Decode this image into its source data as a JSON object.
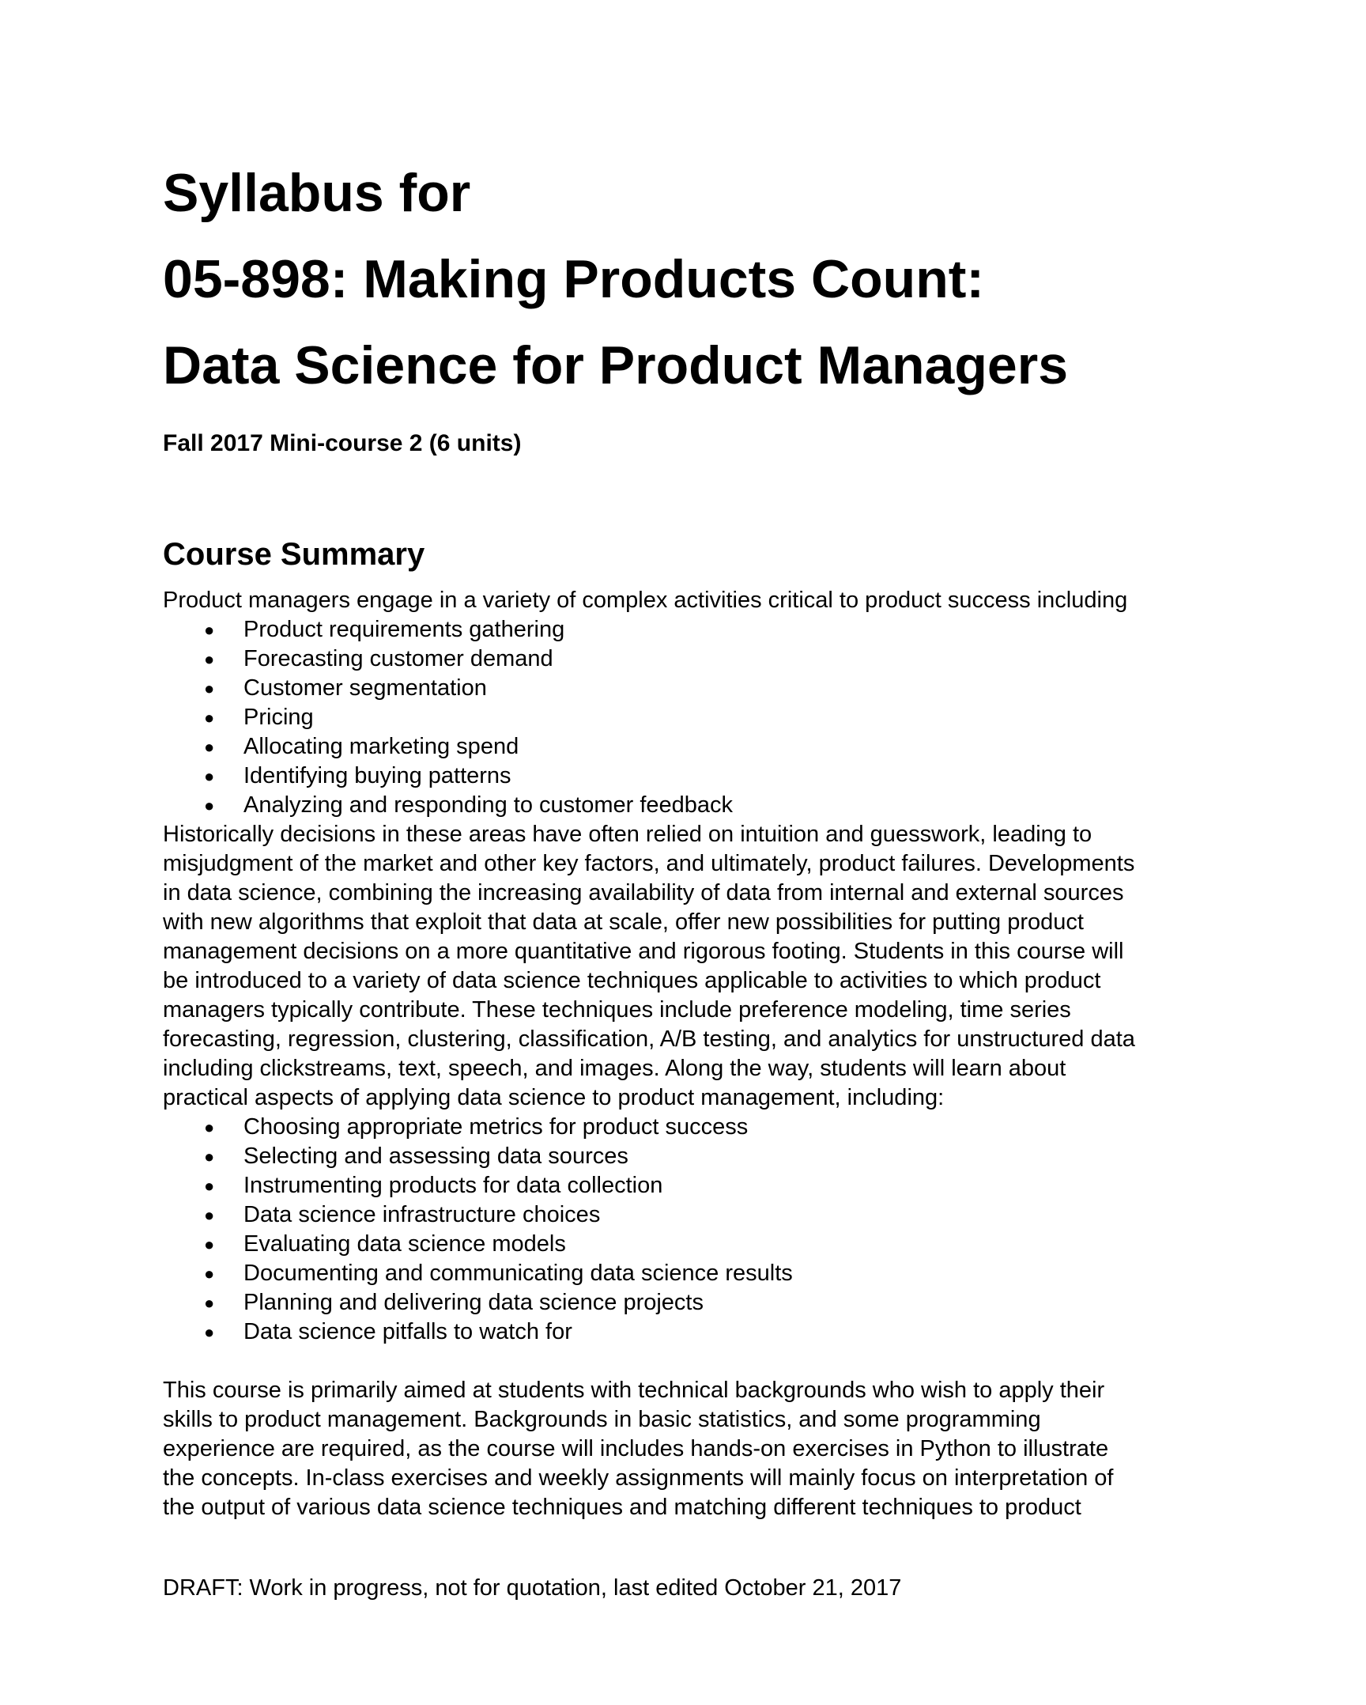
{
  "document": {
    "title_lines": [
      "Syllabus for",
      "05-898: Making Products Count:",
      "Data Science for Product Managers"
    ],
    "subtitle": "Fall 2017 Mini-course 2 (6 units)",
    "section_heading": "Course Summary",
    "intro": "Product managers engage in a variety of complex activities critical to product success including",
    "activities": [
      "Product requirements gathering",
      "Forecasting customer demand",
      "Customer segmentation",
      "Pricing",
      "Allocating marketing spend",
      "Identifying buying patterns",
      "Analyzing and responding to customer feedback"
    ],
    "body_lines": [
      "Historically decisions in these areas have often relied on intuition and guesswork, leading to",
      "misjudgment of the market and other key factors, and ultimately, product failures. Developments",
      "in data science, combining the increasing availability of data from internal and external sources",
      "with new algorithms that exploit that data at scale, offer new possibilities for putting product",
      "management decisions on a more quantitative and rigorous footing. Students in this course will",
      "be introduced to a variety of data science techniques applicable to activities to which product",
      "managers typically contribute. These techniques include preference modeling, time series",
      "forecasting, regression, clustering, classification, A/B testing, and analytics for unstructured data",
      "including clickstreams, text, speech, and images. Along the way, students will learn about",
      "practical aspects of applying data science to product management, including:"
    ],
    "practical_aspects": [
      "Choosing appropriate metrics for product success",
      "Selecting and assessing data sources",
      "Instrumenting products for data collection",
      "Data science infrastructure choices",
      "Evaluating data science models",
      "Documenting and communicating data science results",
      "Planning and delivering data science projects",
      "Data science pitfalls to watch for"
    ],
    "closing_lines": [
      "This course is primarily aimed at students with technical backgrounds who wish to apply their",
      "skills to product management. Backgrounds in basic statistics, and some programming",
      "experience are required, as the course will includes hands-on exercises in Python to illustrate",
      "the concepts. In-class exercises and weekly assignments will mainly focus on interpretation of",
      "the output of various data science techniques and matching different techniques to product"
    ],
    "bullet_glyph": "●",
    "footer": "DRAFT: Work in progress, not for quotation, last edited October 21, 2017"
  }
}
